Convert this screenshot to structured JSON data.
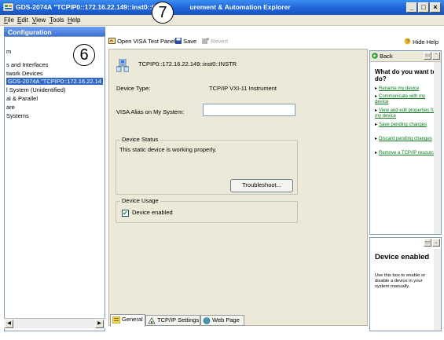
{
  "window": {
    "title_left": "GDS-2074A \"TCPIP0::172.16.22.149::inst0::INS",
    "title_right": "urement & Automation Explorer",
    "minimize": "_",
    "maximize": "□",
    "close": "×"
  },
  "menu": [
    {
      "label": "File",
      "key": "F",
      "rest": "ile"
    },
    {
      "label": "Edit",
      "key": "E",
      "rest": "dit"
    },
    {
      "label": "View",
      "key": "V",
      "rest": "iew"
    },
    {
      "label": "Tools",
      "key": "T",
      "rest": "ools"
    },
    {
      "label": "Help",
      "key": "H",
      "rest": "elp"
    }
  ],
  "sidebar": {
    "header": "Configuration",
    "items": [
      {
        "label": "m"
      },
      {
        "label": "s and Interfaces"
      },
      {
        "label": "twork Devices"
      },
      {
        "label": "GDS-2074A \"TCPIP0::172.16.22.14",
        "selected": true
      },
      {
        "label": "l System (Unidentified)"
      },
      {
        "label": "al & Parallel"
      },
      {
        "label": "are"
      },
      {
        "label": "Systems"
      }
    ]
  },
  "toolbar": {
    "open_visa": "Open VISA Test Panel",
    "save": "Save",
    "revert": "Revert",
    "hide_help": "Hide Help"
  },
  "device": {
    "resource": "TCPIP0::172.16.22.149::inst0::INSTR",
    "type_label": "Device Type:",
    "type_value": "TCP/IP VXI-11 Instrument",
    "alias_label": "VISA Alias on My System:",
    "alias_value": ""
  },
  "status": {
    "group_label": "Device Status",
    "message": "This static device is working properly.",
    "troubleshoot": "Troubleshoot..."
  },
  "usage": {
    "group_label": "Device Usage",
    "enabled_label": "Device enabled",
    "enabled": true
  },
  "tabs": [
    {
      "label": "General",
      "active": true
    },
    {
      "label": "TCP/IP Settings",
      "active": false
    },
    {
      "label": "Web Page",
      "active": false
    }
  ],
  "help": {
    "back": "Back",
    "title": "What do you want to do?",
    "links": [
      "Rename my device",
      "Communicate with my device",
      "View and edit properties for my device",
      "Save pending changes",
      "Discard pending changes",
      "Remove a TCP/IP resource"
    ],
    "lower_title": "Device enabled",
    "lower_text": "Use this box to enable or disable a device in your system manually."
  },
  "callouts": {
    "six": "6",
    "seven": "7"
  },
  "colors": {
    "title_bar": "#1f63d8",
    "selection": "#316ac5",
    "link": "#0b7a1a",
    "panel": "#ece9d8"
  }
}
